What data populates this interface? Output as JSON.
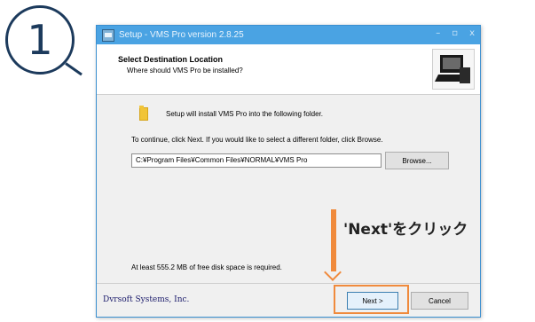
{
  "step": {
    "number": "1"
  },
  "window": {
    "title": "Setup - VMS Pro version 2.8.25",
    "controls": [
      "–",
      "▫",
      "x"
    ]
  },
  "header": {
    "title": "Select Destination Location",
    "subtitle": "Where should VMS Pro be installed?"
  },
  "body": {
    "intro": "Setup will install VMS Pro into the following folder.",
    "continue_text": "To continue, click Next. If you would like to select a different folder, click Browse.",
    "path_value": "C:¥Program Files¥Common Files¥NORMAL¥VMS Pro",
    "browse_label": "Browse...",
    "space_required": "At least 555.2 MB of free disk space is required."
  },
  "footer": {
    "company": "Dvrsoft Systems, Inc.",
    "next_label": "Next >",
    "cancel_label": "Cancel"
  },
  "annotation": {
    "callout": "'Next'をクリック",
    "accent_color": "#f08a3c"
  },
  "colors": {
    "titlebar": "#4aa3e3",
    "step_circle": "#1c3a5c"
  },
  "icons": {
    "app": "setup-app-icon",
    "folder": "folder-icon",
    "logo": "computer-logo-icon"
  }
}
